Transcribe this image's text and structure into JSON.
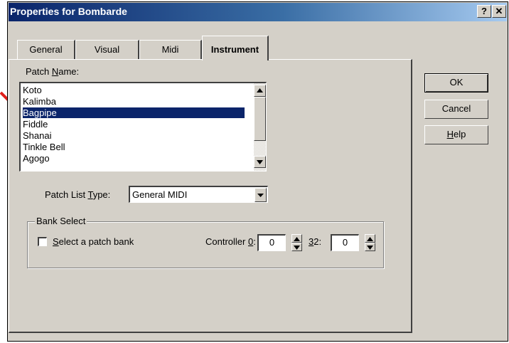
{
  "window": {
    "title": "Properties for Bombarde",
    "help_btn": "?",
    "close_btn": "✕"
  },
  "tabs": [
    {
      "label": "General"
    },
    {
      "label": "Visual"
    },
    {
      "label": "Midi"
    },
    {
      "label": "Instrument"
    }
  ],
  "patch": {
    "label_pre": "Patch ",
    "label_key": "N",
    "label_post": "ame:",
    "items": [
      "Koto",
      "Kalimba",
      "Bagpipe",
      "Fiddle",
      "Shanai",
      "Tinkle Bell",
      "Agogo"
    ],
    "selected_index": 2
  },
  "patch_list_type": {
    "label_pre": "Patch List ",
    "label_key": "T",
    "label_post": "ype:",
    "value": "General MIDI"
  },
  "bank_select": {
    "group_label": "Bank Select",
    "checkbox_key": "S",
    "checkbox_rest": "elect a patch bank",
    "checked": false,
    "controller_pre": "Controller ",
    "controller_key": "0",
    "controller_post": ":",
    "controller_value": "0",
    "c32_key": "3",
    "c32_post": "2:",
    "c32_value": "0"
  },
  "buttons": {
    "ok": "OK",
    "cancel": "Cancel",
    "help_key": "H",
    "help_rest": "elp"
  },
  "colors": {
    "titlebar_start": "#0a246a",
    "selection": "#0a246a",
    "arrow": "#e0201a",
    "face": "#d4d0c8"
  }
}
